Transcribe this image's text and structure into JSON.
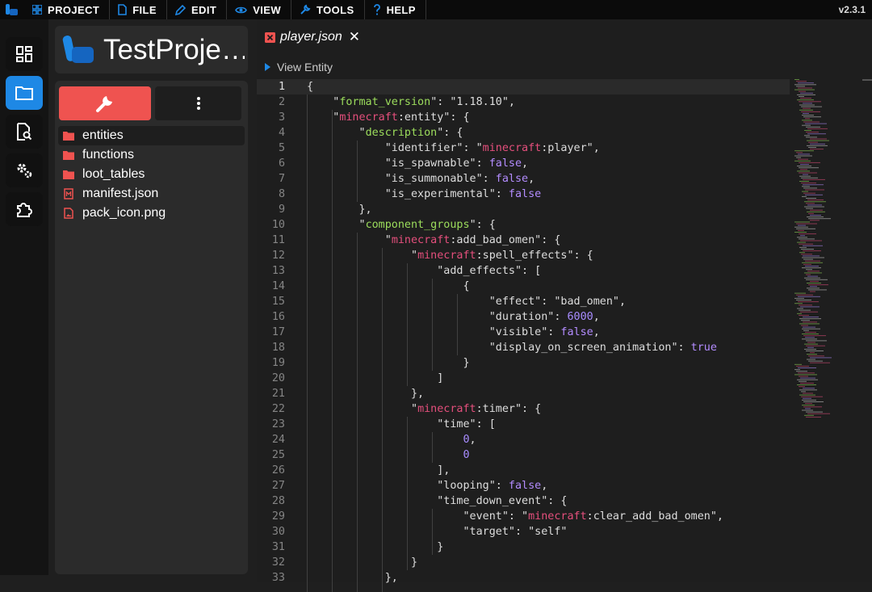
{
  "menu": {
    "items": [
      {
        "label": "PROJECT",
        "icon": "grid-icon"
      },
      {
        "label": "FILE",
        "icon": "file-icon"
      },
      {
        "label": "EDIT",
        "icon": "pencil-icon"
      },
      {
        "label": "VIEW",
        "icon": "eye-icon"
      },
      {
        "label": "TOOLS",
        "icon": "wrench-icon"
      },
      {
        "label": "HELP",
        "icon": "question-icon"
      }
    ],
    "version": "v2.3.1"
  },
  "activity_bar": [
    "dashboard-icon",
    "folder-icon",
    "file-search-icon",
    "gears-icon",
    "puzzle-icon"
  ],
  "project": {
    "title": "TestProje…"
  },
  "file_tree": [
    {
      "label": "entities",
      "type": "folder",
      "selected": true
    },
    {
      "label": "functions",
      "type": "folder"
    },
    {
      "label": "loot_tables",
      "type": "folder"
    },
    {
      "label": "manifest.json",
      "type": "json-file"
    },
    {
      "label": "pack_icon.png",
      "type": "image-file"
    }
  ],
  "editor": {
    "tab_label": "player.json",
    "breadcrumb": "View Entity",
    "lines": [
      [
        {
          "t": "{",
          "c": "p"
        }
      ],
      [
        {
          "t": "    \"",
          "c": "p"
        },
        {
          "t": "format_version",
          "c": "k"
        },
        {
          "t": "\": \"1.18.10\",",
          "c": "p"
        }
      ],
      [
        {
          "t": "    \"",
          "c": "p"
        },
        {
          "t": "minecraft",
          "c": "ns"
        },
        {
          "t": ":entity\": {",
          "c": "p"
        }
      ],
      [
        {
          "t": "        \"",
          "c": "p"
        },
        {
          "t": "description",
          "c": "k"
        },
        {
          "t": "\": {",
          "c": "p"
        }
      ],
      [
        {
          "t": "            \"identifier\": \"",
          "c": "p"
        },
        {
          "t": "minecraft",
          "c": "ns"
        },
        {
          "t": ":player\",",
          "c": "p"
        }
      ],
      [
        {
          "t": "            \"is_spawnable\": ",
          "c": "p"
        },
        {
          "t": "false",
          "c": "kw"
        },
        {
          "t": ",",
          "c": "p"
        }
      ],
      [
        {
          "t": "            \"is_summonable\": ",
          "c": "p"
        },
        {
          "t": "false",
          "c": "kw"
        },
        {
          "t": ",",
          "c": "p"
        }
      ],
      [
        {
          "t": "            \"is_experimental\": ",
          "c": "p"
        },
        {
          "t": "false",
          "c": "kw"
        }
      ],
      [
        {
          "t": "        },",
          "c": "p"
        }
      ],
      [
        {
          "t": "        \"",
          "c": "p"
        },
        {
          "t": "component_groups",
          "c": "k"
        },
        {
          "t": "\": {",
          "c": "p"
        }
      ],
      [
        {
          "t": "            \"",
          "c": "p"
        },
        {
          "t": "minecraft",
          "c": "ns"
        },
        {
          "t": ":add_bad_omen\": {",
          "c": "p"
        }
      ],
      [
        {
          "t": "                \"",
          "c": "p"
        },
        {
          "t": "minecraft",
          "c": "ns"
        },
        {
          "t": ":spell_effects\": {",
          "c": "p"
        }
      ],
      [
        {
          "t": "                    \"add_effects\": [",
          "c": "p"
        }
      ],
      [
        {
          "t": "                        {",
          "c": "p"
        }
      ],
      [
        {
          "t": "                            \"effect\": \"bad_omen\",",
          "c": "p"
        }
      ],
      [
        {
          "t": "                            \"duration\": ",
          "c": "p"
        },
        {
          "t": "6000",
          "c": "nm"
        },
        {
          "t": ",",
          "c": "p"
        }
      ],
      [
        {
          "t": "                            \"visible\": ",
          "c": "p"
        },
        {
          "t": "false",
          "c": "kw"
        },
        {
          "t": ",",
          "c": "p"
        }
      ],
      [
        {
          "t": "                            \"display_on_screen_animation\": ",
          "c": "p"
        },
        {
          "t": "true",
          "c": "kw"
        }
      ],
      [
        {
          "t": "                        }",
          "c": "p"
        }
      ],
      [
        {
          "t": "                    ]",
          "c": "p"
        }
      ],
      [
        {
          "t": "                },",
          "c": "p"
        }
      ],
      [
        {
          "t": "                \"",
          "c": "p"
        },
        {
          "t": "minecraft",
          "c": "ns"
        },
        {
          "t": ":timer\": {",
          "c": "p"
        }
      ],
      [
        {
          "t": "                    \"time\": [",
          "c": "p"
        }
      ],
      [
        {
          "t": "                        ",
          "c": "p"
        },
        {
          "t": "0",
          "c": "nm"
        },
        {
          "t": ",",
          "c": "p"
        }
      ],
      [
        {
          "t": "                        ",
          "c": "p"
        },
        {
          "t": "0",
          "c": "nm"
        }
      ],
      [
        {
          "t": "                    ],",
          "c": "p"
        }
      ],
      [
        {
          "t": "                    \"looping\": ",
          "c": "p"
        },
        {
          "t": "false",
          "c": "kw"
        },
        {
          "t": ",",
          "c": "p"
        }
      ],
      [
        {
          "t": "                    \"time_down_event\": {",
          "c": "p"
        }
      ],
      [
        {
          "t": "                        \"event\": \"",
          "c": "p"
        },
        {
          "t": "minecraft",
          "c": "ns"
        },
        {
          "t": ":clear_add_bad_omen\",",
          "c": "p"
        }
      ],
      [
        {
          "t": "                        \"target\": \"self\"",
          "c": "p"
        }
      ],
      [
        {
          "t": "                    }",
          "c": "p"
        }
      ],
      [
        {
          "t": "                }",
          "c": "p"
        }
      ],
      [
        {
          "t": "            },",
          "c": "p"
        }
      ]
    ]
  }
}
